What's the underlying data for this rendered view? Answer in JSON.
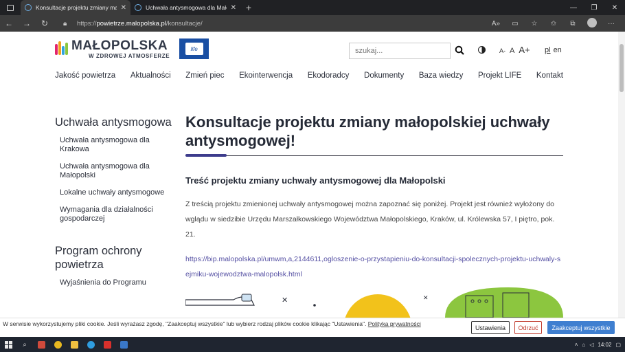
{
  "browser": {
    "tabs": [
      {
        "title": "Konsultacje projektu zmiany mał",
        "active": true
      },
      {
        "title": "Uchwała antysmogowa dla Mało",
        "active": false
      }
    ],
    "url_scheme": "https://",
    "url_host": "powietrze.malopolska.pl",
    "url_path": "/konsultacje/"
  },
  "header": {
    "logo_name": "MAŁOPOLSKA",
    "logo_sub": "W ZDROWEJ ATMOSFERZE",
    "eu_badge": "life",
    "search_placeholder": "szukaj...",
    "font_small": "A-",
    "font_medium": "A",
    "font_large": "A+",
    "lang_pl": "pl",
    "lang_en": "en"
  },
  "nav": [
    "Jakość powietrza",
    "Aktualności",
    "Zmień piec",
    "Ekointerwencja",
    "Ekodoradcy",
    "Dokumenty",
    "Baza wiedzy",
    "Projekt LIFE",
    "Kontakt"
  ],
  "sidebar": {
    "section1_title": "Uchwała antysmogowa",
    "section1_items": [
      "Uchwała antysmogowa dla Krakowa",
      "Uchwała antysmogowa dla Małopolski",
      "Lokalne uchwały antysmogowe",
      "Wymagania dla działalności gospodarczej"
    ],
    "section2_title": "Program ochrony powietrza",
    "section2_items": [
      "Wyjaśnienia do Programu"
    ]
  },
  "content": {
    "title": "Konsultacje projektu zmiany małopolskiej uchwały antysmogowej!",
    "subtitle": "Treść projektu zmiany uchwały antysmogowej dla Małopolski",
    "paragraph": "Z treścią projektu zmienionej uchwały antysmogowej można zapoznać się poniżej. Projekt jest również wyłożony do wglądu w siedzibie Urzędu Marszałkowskiego Województwa Małopolskiego, Kraków, ul. Królewska 57, I piętro, pok. 21.",
    "link": "https://bip.malopolska.pl/umwm,a,2144611,ogloszenie-o-przystapieniu-do-konsultacji-spolecznych-projektu-uchwaly-sejmiku-wojewodztwa-malopolsk.html"
  },
  "cookie": {
    "text": "W serwisie wykorzystujemy pliki cookie. Jeśli wyrażasz zgodę, \"Zaakceptuj wszystkie\" lub wybierz rodzaj plików cookie klikając \"Ustawienia\". ",
    "policy_link": "Polityka prywatności",
    "settings_label": "Ustawienia",
    "reject_label": "Odrzuć",
    "accept_label": "Zaakceptuj wszystkie"
  },
  "taskbar": {
    "time": "14:02"
  },
  "colors": {
    "accent": "#3d3c8c",
    "link": "#5550a3",
    "accept_button": "#3f7fd0",
    "reject_button": "#c0392b",
    "illustration_yellow": "#f2c21b",
    "illustration_green": "#8cc63f"
  }
}
